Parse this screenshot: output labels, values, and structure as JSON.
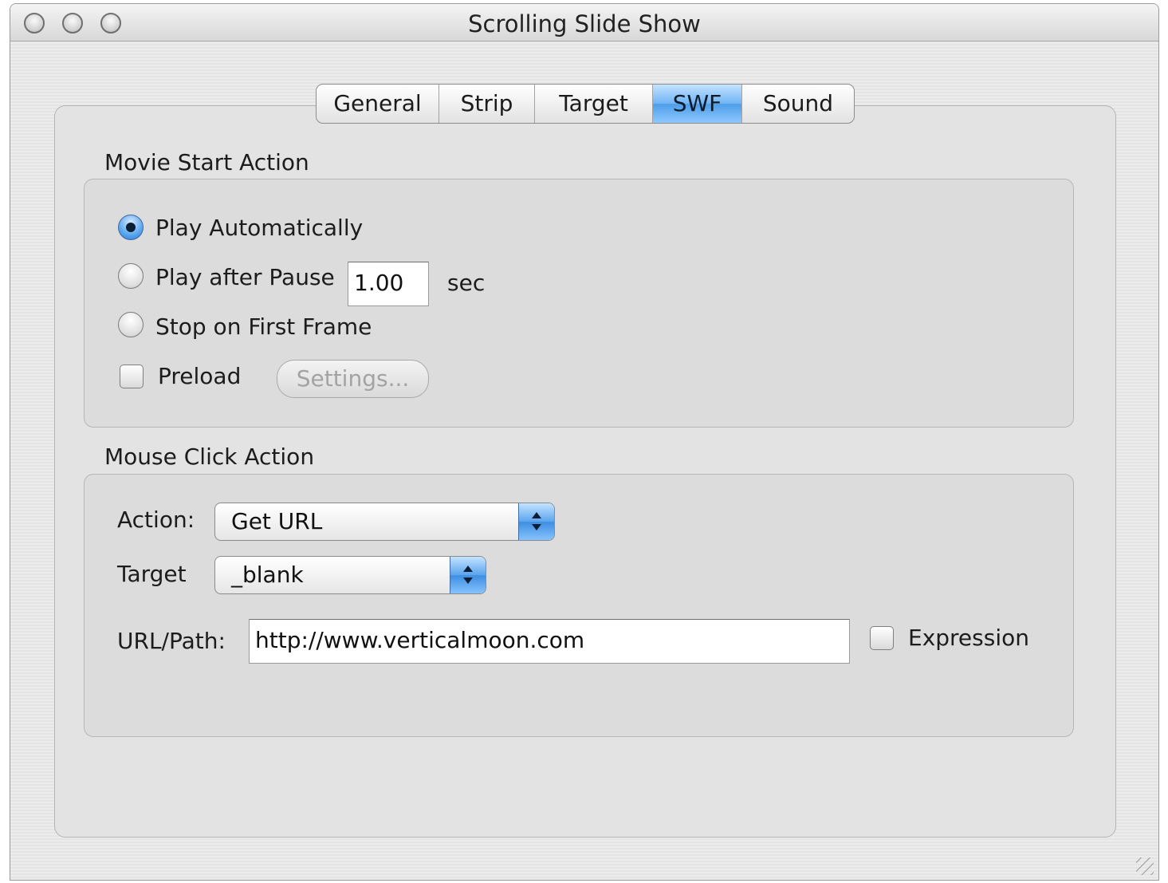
{
  "window": {
    "title": "Scrolling Slide Show"
  },
  "tabs": [
    {
      "label": "General",
      "active": false
    },
    {
      "label": "Strip",
      "active": false
    },
    {
      "label": "Target",
      "active": false
    },
    {
      "label": "SWF",
      "active": true
    },
    {
      "label": "Sound",
      "active": false
    }
  ],
  "movie_start": {
    "group_label": "Movie Start Action",
    "options": [
      {
        "label": "Play Automatically",
        "selected": true
      },
      {
        "label": "Play after Pause",
        "selected": false
      },
      {
        "label": "Stop on First Frame",
        "selected": false
      }
    ],
    "pause_value": "1.00",
    "pause_unit": "sec",
    "preload_label": "Preload",
    "preload_checked": false,
    "settings_button": "Settings..."
  },
  "mouse_click": {
    "group_label": "Mouse Click Action",
    "action_label": "Action:",
    "action_value": "Get URL",
    "target_label": "Target",
    "target_value": "_blank",
    "url_label": "URL/Path:",
    "url_value": "http://www.verticalmoon.com",
    "expression_label": "Expression",
    "expression_checked": false
  },
  "colors": {
    "accent": "#5aa4ee",
    "panel": "#e3e3e3"
  }
}
